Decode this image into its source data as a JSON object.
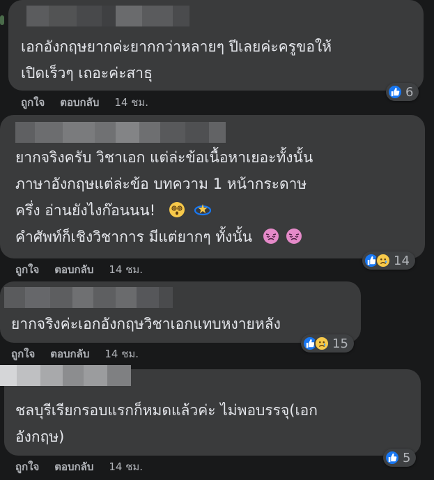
{
  "comments": [
    {
      "lines": [
        "เอกอังกฤษยากค่ะยากกว่าหลายๆ ปีเลยค่ะครูขอให้",
        "เปิดเร็วๆ เถอะค่ะสาธุ"
      ],
      "reaction_count": "6",
      "reaction_icons": [
        "like-icon"
      ]
    },
    {
      "lines": [
        "ยากจริงครับ วิชาเอก แต่ล่ะข้อเนื้อหาเยอะทั้งนั้น",
        "ภาษาอังกฤษแต่ล่ะข้อ บทความ 1 หน้ากระดาษ",
        "ครึ่ง อ่านยังไงก๊อนนน!",
        "คำศัพท์ก็เชิงวิชาการ มีแต่ยากๆ ทั้งนั้น"
      ],
      "line_emojis": [
        "",
        "",
        "dizzy-face-icon dizzy-star-icon",
        "woozy-face-icon woozy-face-icon"
      ],
      "reaction_count": "14",
      "reaction_icons": [
        "like-icon",
        "sad-icon"
      ]
    },
    {
      "lines": [
        "ยากจริงค่ะเอกอังกฤษวิชาเอกแทบหงายหลัง"
      ],
      "reaction_count": "15",
      "reaction_icons": [
        "like-icon",
        "sad-icon"
      ]
    },
    {
      "lines": [
        "ชลบุรีเรียกรอบแรกก็หมดแล้วค่ะ ไม่พอบรรจุ(เอก",
        "อังกฤษ)"
      ],
      "reaction_count": "5",
      "reaction_icons": [
        "like-icon"
      ]
    }
  ],
  "actions": {
    "like_label": "ถูกใจ",
    "reply_label": "ตอบกลับ",
    "time_label": "14 ชม."
  },
  "colors": {
    "background": "#18191a",
    "bubble": "#3a3b3c",
    "text": "#e4e6eb",
    "secondary_text": "#b0b3b8",
    "like_blue": "#1877f2",
    "sad_yellow": "#f7c94a"
  }
}
